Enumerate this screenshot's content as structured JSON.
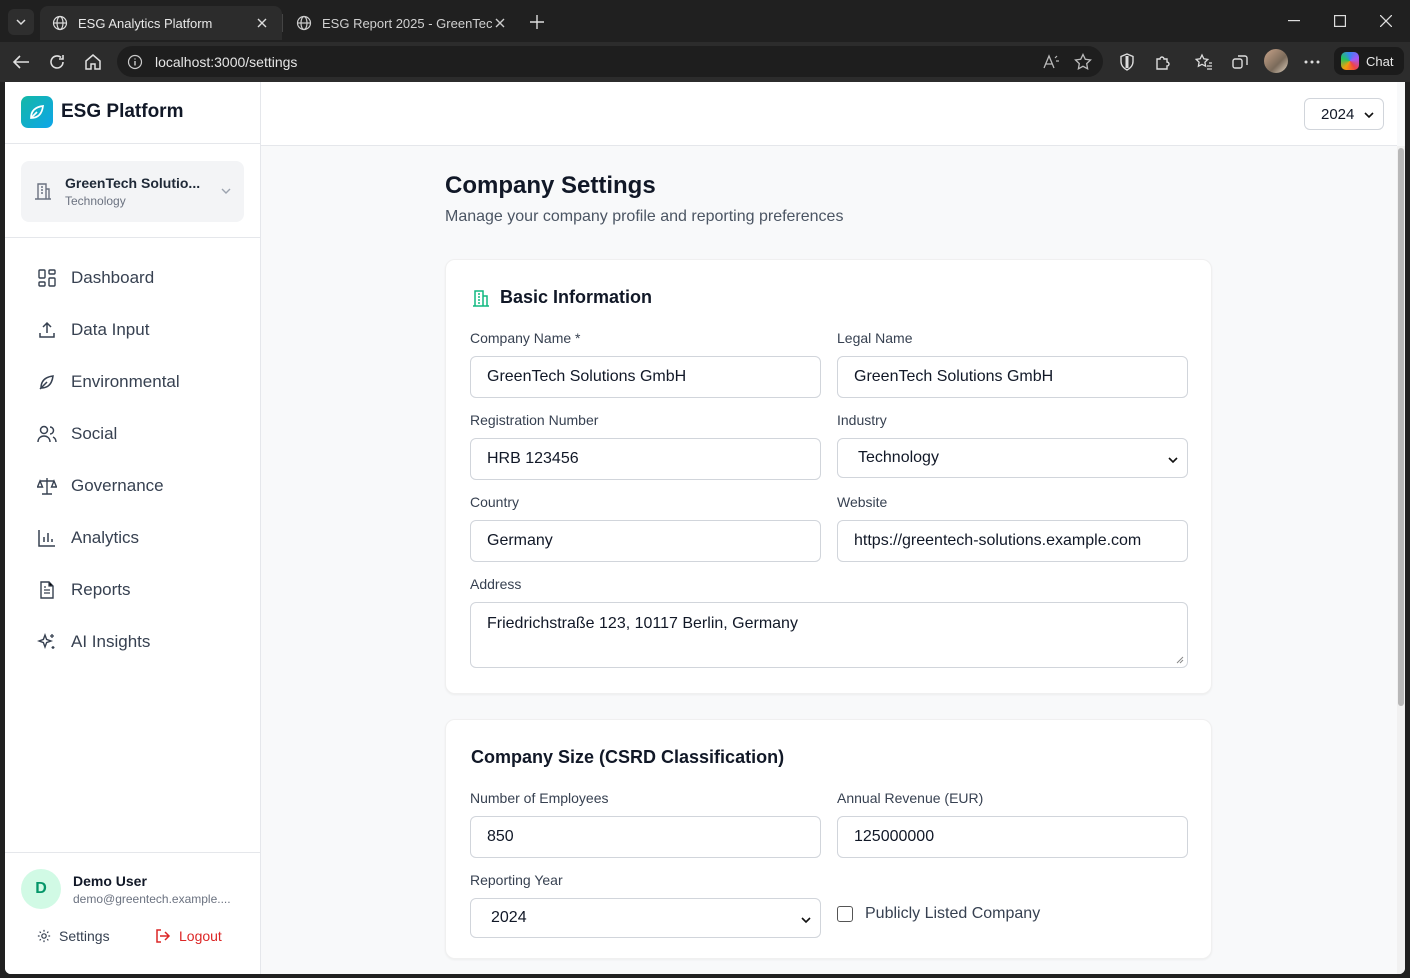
{
  "browser": {
    "tabs": [
      {
        "title": "ESG Analytics Platform",
        "active": true
      },
      {
        "title": "ESG Report 2025 - GreenTech Sol",
        "active": false
      }
    ],
    "url": "localhost:3000/settings",
    "chat_label": "Chat"
  },
  "sidebar": {
    "brand": "ESG Platform",
    "company": {
      "name": "GreenTech Solutio...",
      "industry": "Technology"
    },
    "nav": [
      {
        "label": "Dashboard",
        "icon": "dashboard-icon"
      },
      {
        "label": "Data Input",
        "icon": "upload-icon"
      },
      {
        "label": "Environmental",
        "icon": "leaf-icon"
      },
      {
        "label": "Social",
        "icon": "users-icon"
      },
      {
        "label": "Governance",
        "icon": "scale-icon"
      },
      {
        "label": "Analytics",
        "icon": "bar-chart-icon"
      },
      {
        "label": "Reports",
        "icon": "document-icon"
      },
      {
        "label": "AI Insights",
        "icon": "sparkles-icon"
      }
    ],
    "user": {
      "initial": "D",
      "name": "Demo User",
      "email": "demo@greentech.example...."
    },
    "settings_label": "Settings",
    "logout_label": "Logout"
  },
  "header": {
    "year": "2024"
  },
  "page": {
    "title": "Company Settings",
    "subtitle": "Manage your company profile and reporting preferences"
  },
  "basic": {
    "title": "Basic Information",
    "company_name_label": "Company Name *",
    "company_name": "GreenTech Solutions GmbH",
    "legal_name_label": "Legal Name",
    "legal_name": "GreenTech Solutions GmbH",
    "registration_label": "Registration Number",
    "registration": "HRB 123456",
    "industry_label": "Industry",
    "industry": "Technology",
    "country_label": "Country",
    "country": "Germany",
    "website_label": "Website",
    "website": "https://greentech-solutions.example.com",
    "address_label": "Address",
    "address": "Friedrichstraße 123, 10117 Berlin, Germany"
  },
  "size": {
    "title": "Company Size (CSRD Classification)",
    "employees_label": "Number of Employees",
    "employees": "850",
    "revenue_label": "Annual Revenue (EUR)",
    "revenue": "125000000",
    "reporting_year_label": "Reporting Year",
    "reporting_year": "2024",
    "listed_label": "Publicly Listed Company",
    "listed": false
  },
  "colors": {
    "accent": "#10b981",
    "brand_gradient": "#14b8a6",
    "logout": "#dc2626"
  }
}
